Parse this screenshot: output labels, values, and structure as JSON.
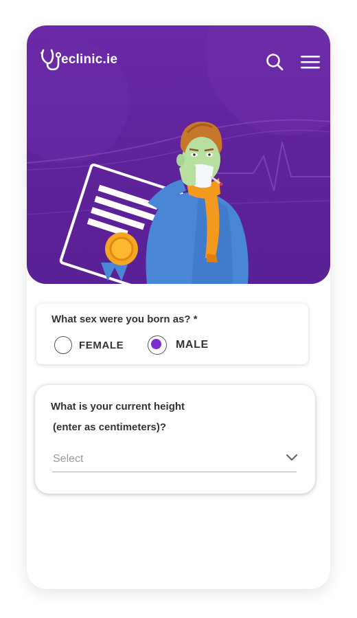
{
  "brand": {
    "logo_text": "eclinic.ie"
  },
  "header": {
    "search_icon": "search-icon",
    "menu_icon": "hamburger-menu-icon"
  },
  "colors": {
    "brand_purple": "#5e229a",
    "radio_selected": "#7b2fd0",
    "scarf": "#f39a1e",
    "sweater": "#4a86d6"
  },
  "sex_question": {
    "label": "What sex were you born as? *",
    "options": [
      {
        "label": "FEMALE",
        "selected": false
      },
      {
        "label": "MALE",
        "selected": true
      }
    ]
  },
  "height_question": {
    "label_line1": "What is your current height",
    "label_line2": "(enter as centimeters)?",
    "select": {
      "value": "Select"
    }
  }
}
